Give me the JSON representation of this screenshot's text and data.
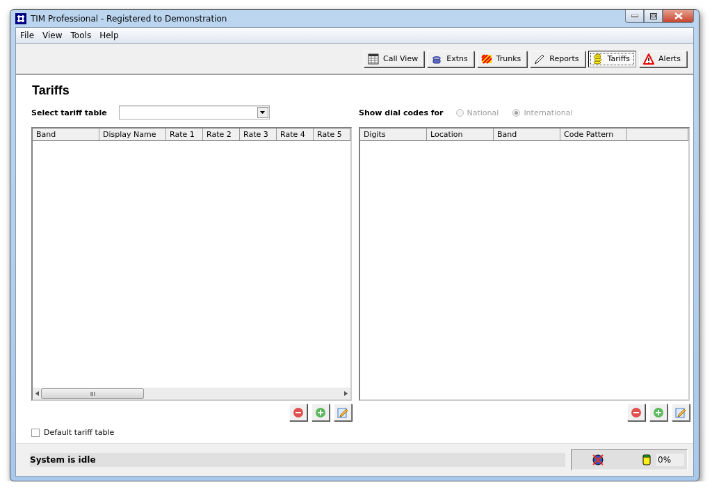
{
  "window": {
    "title": "TIM Professional - Registered to Demonstration"
  },
  "menu": [
    "File",
    "View",
    "Tools",
    "Help"
  ],
  "toolbar": [
    {
      "label": "Call View",
      "kind": "grid",
      "selected": false
    },
    {
      "label": "Extns",
      "kind": "phone",
      "selected": false
    },
    {
      "label": "Trunks",
      "kind": "stripes",
      "selected": false
    },
    {
      "label": "Reports",
      "kind": "pen",
      "selected": false
    },
    {
      "label": "Tariffs",
      "kind": "coins",
      "selected": true
    },
    {
      "label": "Alerts",
      "kind": "warning",
      "selected": false
    }
  ],
  "page_title": "Tariffs",
  "tariff_select": {
    "label": "Select tariff table"
  },
  "dial_codes": {
    "label": "Show dial codes for",
    "options": [
      {
        "label": "National",
        "selected": false,
        "disabled": true
      },
      {
        "label": "International",
        "selected": true,
        "disabled": true
      }
    ]
  },
  "bands_table": {
    "columns": [
      "Band",
      "Display Name",
      "Rate 1",
      "Rate 2",
      "Rate 3",
      "Rate 4",
      "Rate 5"
    ]
  },
  "codes_table": {
    "columns": [
      "Digits",
      "Location",
      "Band",
      "Code Pattern"
    ]
  },
  "default_checkbox": {
    "label": "Default tariff table",
    "checked": false
  },
  "status_bar": {
    "message": "System is idle",
    "usage": "0%"
  }
}
